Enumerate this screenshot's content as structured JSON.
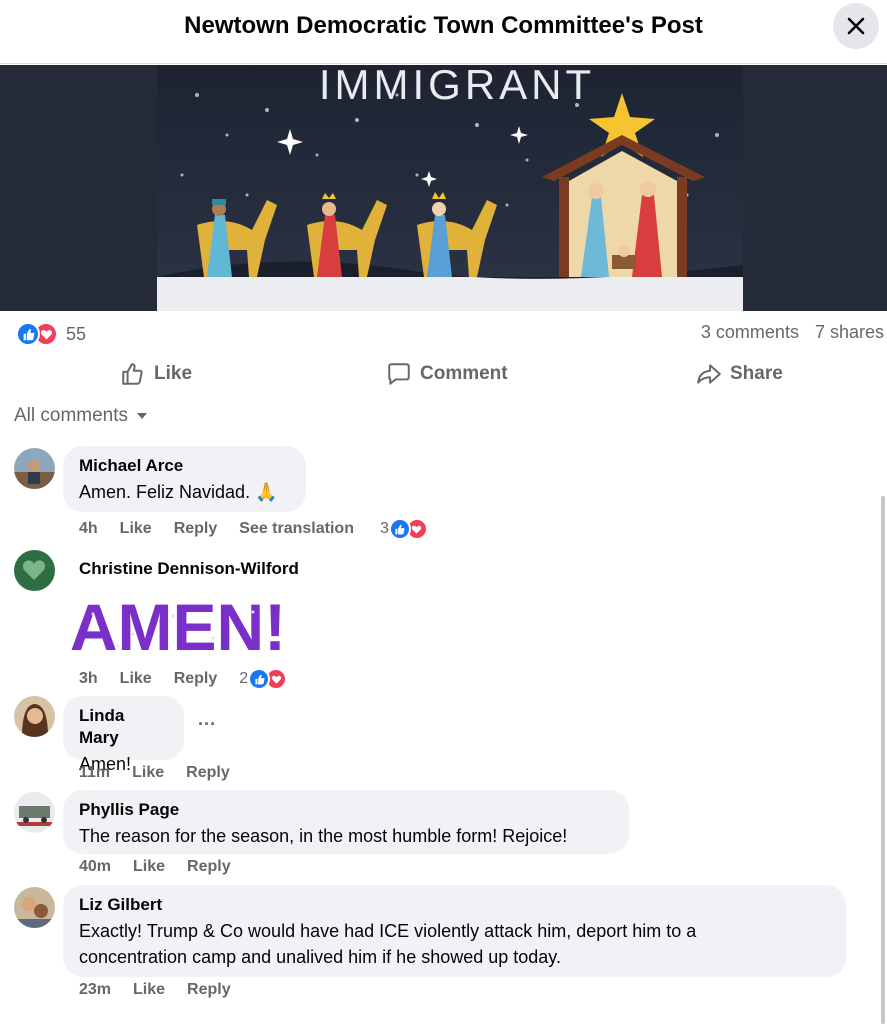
{
  "header": {
    "title": "Newtown Democratic Town Committee's Post"
  },
  "post_image": {
    "caption_text": "IMMIGRANT"
  },
  "reactions": {
    "count": "55",
    "comments": "3 comments",
    "shares": "7 shares"
  },
  "actions": {
    "like": "Like",
    "comment": "Comment",
    "share": "Share"
  },
  "comments_filter": {
    "label": "All comments"
  },
  "comments": [
    {
      "name": "Michael Arce",
      "text": "Amen. Feliz Navidad. 🙏",
      "time": "4h",
      "like": "Like",
      "reply": "Reply",
      "translate": "See translation",
      "reaction_count": "3"
    },
    {
      "name": "Christine Dennison-Wilford",
      "sticker_text": "AMEN!",
      "time": "3h",
      "like": "Like",
      "reply": "Reply",
      "reaction_count": "2"
    },
    {
      "name": "Linda Mary",
      "text": "Amen!",
      "time": "11m",
      "like": "Like",
      "reply": "Reply",
      "more": "···"
    },
    {
      "name": "Phyllis Page",
      "text": "The reason for the season, in the most humble form! Rejoice!",
      "time": "40m",
      "like": "Like",
      "reply": "Reply"
    },
    {
      "name": "Liz Gilbert",
      "text": "Exactly! Trump & Co would have had ICE violently attack him, deport him to a concentration camp and unalived him if he showed up today.",
      "time": "23m",
      "like": "Like",
      "reply": "Reply"
    }
  ],
  "colors": {
    "like_blue": "#1877f2",
    "love_red": "#f33e58",
    "bubble_bg": "#f0f2f5",
    "secondary_text": "#65676b",
    "sticker_purple": "#7b2fc9"
  }
}
